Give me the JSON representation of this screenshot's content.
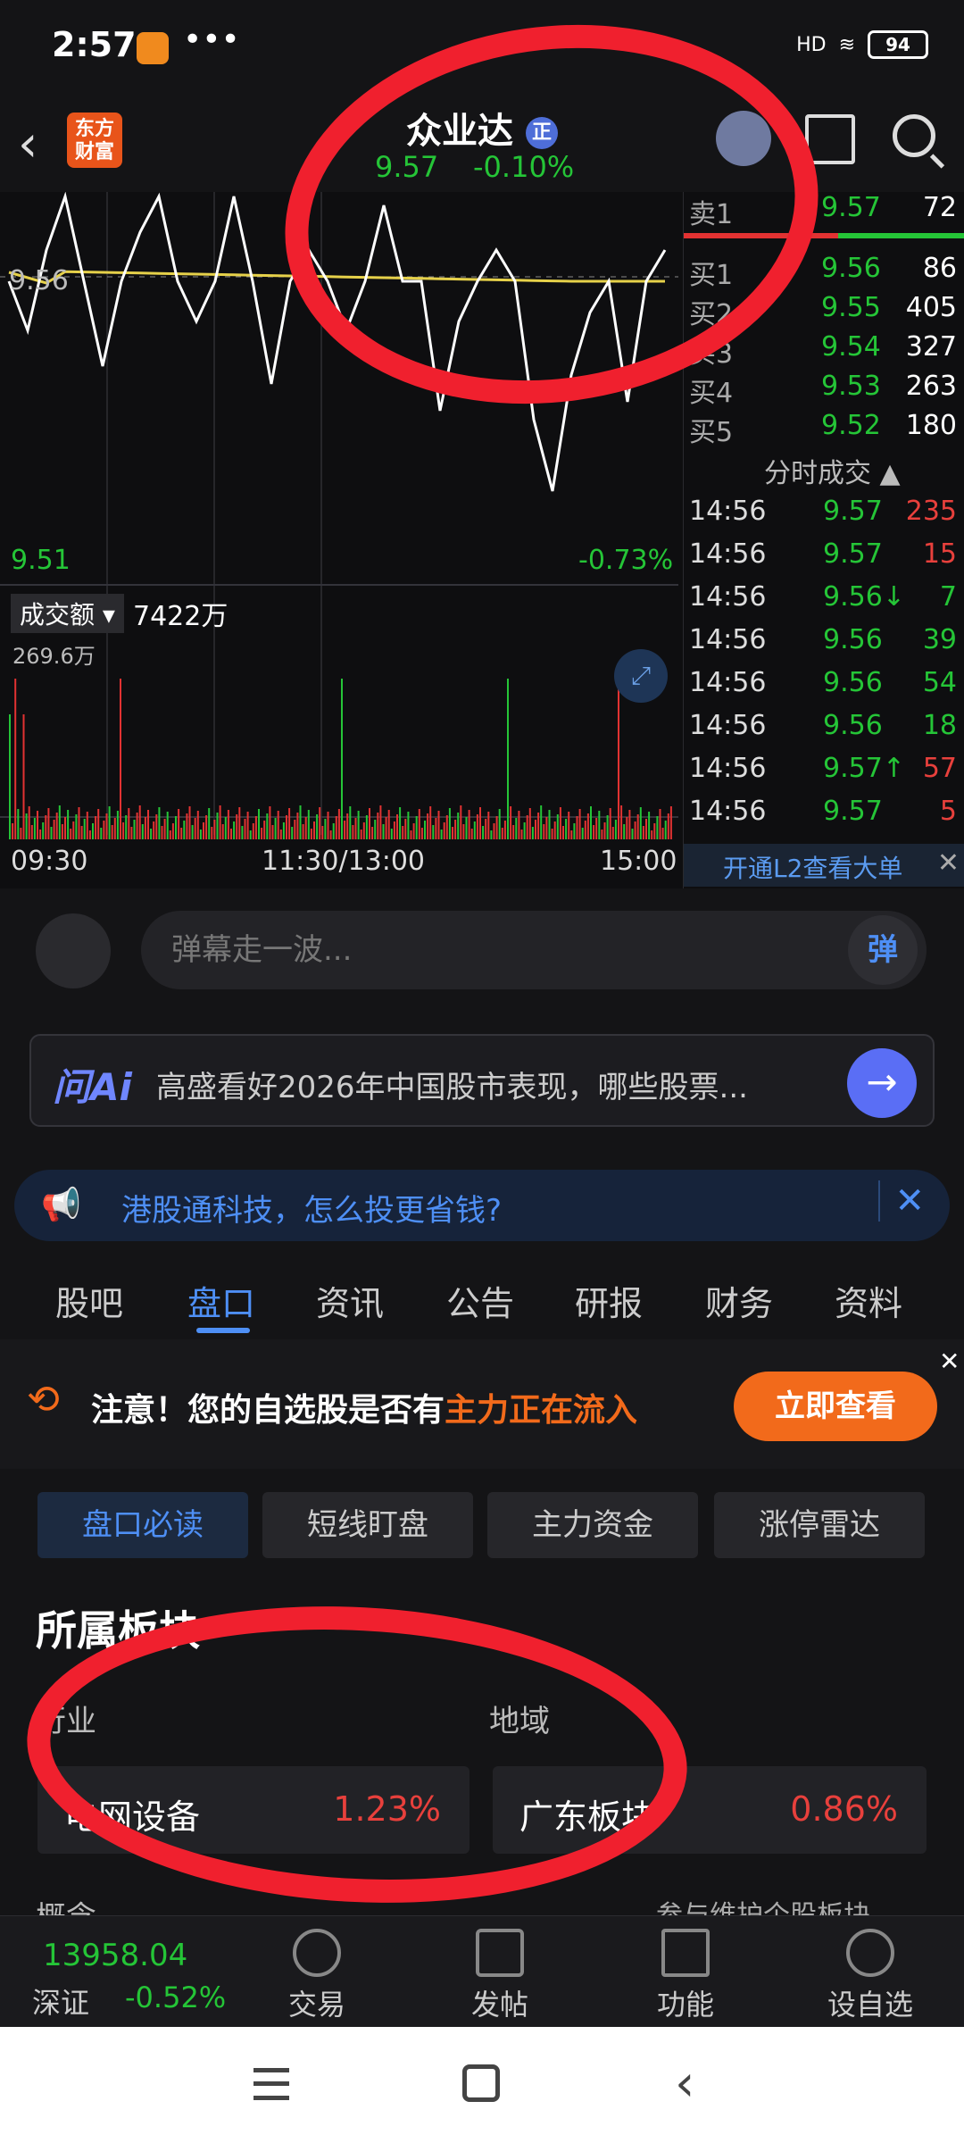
{
  "status_bar": {
    "time": "2:57",
    "dots": "•••",
    "signal": "HD",
    "battery": "94"
  },
  "header": {
    "logo_text": "东方\n财富",
    "stock_name": "众业达",
    "stock_badge": "正",
    "price": "9.57",
    "change": "-0.10%"
  },
  "chart": {
    "y_top_label": "9.56",
    "y_bottom_label": "9.51",
    "right_bottom_change": "-0.73%",
    "volume_label": "成交额",
    "volume_value": "7422万",
    "volume_max": "269.6万",
    "x_labels": [
      "09:30",
      "11:30/13:00",
      "15:00"
    ]
  },
  "orderbook": {
    "sell": [
      {
        "label": "卖1",
        "price": "9.57",
        "volume": "72"
      }
    ],
    "buy": [
      {
        "label": "买1",
        "price": "9.56",
        "volume": "86"
      },
      {
        "label": "买2",
        "price": "9.55",
        "volume": "405"
      },
      {
        "label": "买3",
        "price": "9.54",
        "volume": "327"
      },
      {
        "label": "买4",
        "price": "9.53",
        "volume": "263"
      },
      {
        "label": "买5",
        "price": "9.52",
        "volume": "180"
      }
    ],
    "trades_header": "分时成交 ▲",
    "trades": [
      {
        "time": "14:56",
        "price": "9.57",
        "volume": "235",
        "color": "#e8403c"
      },
      {
        "time": "14:56",
        "price": "9.57",
        "volume": "15",
        "color": "#e8403c"
      },
      {
        "time": "14:56",
        "price": "9.56↓",
        "volume": "7",
        "color": "#25c537"
      },
      {
        "time": "14:56",
        "price": "9.56",
        "volume": "39",
        "color": "#25c537"
      },
      {
        "time": "14:56",
        "price": "9.56",
        "volume": "54",
        "color": "#25c537"
      },
      {
        "time": "14:56",
        "price": "9.56",
        "volume": "18",
        "color": "#25c537"
      },
      {
        "time": "14:56",
        "price": "9.57↑",
        "volume": "57",
        "color": "#e8403c"
      },
      {
        "time": "14:56",
        "price": "9.57",
        "volume": "5",
        "color": "#e8403c"
      }
    ],
    "l2_text": "开通L2查看大单"
  },
  "danmu": {
    "placeholder": "弹幕走一波...",
    "button": "弹"
  },
  "ai": {
    "logo": "问Ai",
    "text": "高盛看好2026年中国股市表现，哪些股票..."
  },
  "notice": {
    "text": "港股通科技，怎么投更省钱?"
  },
  "tabs": [
    "股吧",
    "盘口",
    "资讯",
    "公告",
    "研报",
    "财务",
    "资料"
  ],
  "alert": {
    "text_prefix": "注意！您的自选股是否有",
    "text_highlight": "主力正在流入",
    "cta": "立即查看"
  },
  "subtabs": [
    "盘口必读",
    "短线盯盘",
    "主力资金",
    "涨停雷达"
  ],
  "sectors": {
    "title": "所属板块",
    "industry_label": "行业",
    "region_label": "地域",
    "industry": {
      "name": "电网设备",
      "change": "1.23%"
    },
    "region": {
      "name": "广东板块",
      "change": "0.86%"
    },
    "concept_label": "概念",
    "maintain_link": "参与维护个股板块"
  },
  "bottom_bar": {
    "index_value": "13958.04",
    "index_name": "深证",
    "index_change": "-0.52%",
    "items": [
      "交易",
      "发帖",
      "功能",
      "设自选"
    ]
  },
  "colors": {
    "up": "#e8403c",
    "down": "#25c537",
    "accent": "#4e8ff5",
    "alert": "#f26a1b"
  }
}
